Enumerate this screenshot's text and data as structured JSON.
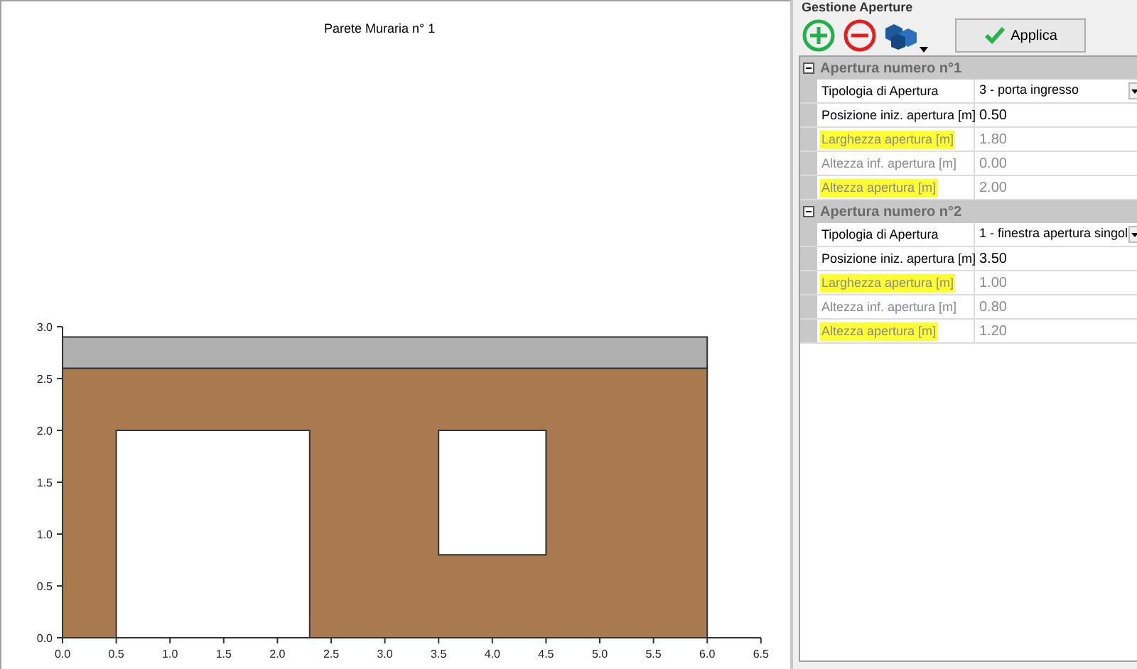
{
  "panel_title": "Gestione Aperture",
  "toolbar": {
    "apply_button": "Applica"
  },
  "sections": [
    {
      "title": "Apertura numero n°1",
      "expanded": true,
      "rows": [
        {
          "kind": "dropdown",
          "label": "Tipologia di Apertura",
          "value": "3 - porta ingresso",
          "highlighted": false,
          "disabled": false
        },
        {
          "kind": "text",
          "label": "Posizione iniz. apertura [m]",
          "value": "0.50",
          "highlighted": false,
          "disabled": false
        },
        {
          "kind": "text",
          "label": "Larghezza apertura [m]",
          "value": "1.80",
          "highlighted": true,
          "disabled": true
        },
        {
          "kind": "text",
          "label": "Altezza inf. apertura [m]",
          "value": "0.00",
          "highlighted": false,
          "disabled": true
        },
        {
          "kind": "text",
          "label": "Altezza apertura [m]",
          "value": "2.00",
          "highlighted": true,
          "disabled": true
        }
      ]
    },
    {
      "title": "Apertura numero n°2",
      "expanded": true,
      "rows": [
        {
          "kind": "dropdown",
          "label": "Tipologia di Apertura",
          "value": "1 - finestra apertura singol",
          "highlighted": false,
          "disabled": false
        },
        {
          "kind": "text",
          "label": "Posizione iniz. apertura [m]",
          "value": "3.50",
          "highlighted": false,
          "disabled": false
        },
        {
          "kind": "text",
          "label": "Larghezza apertura [m]",
          "value": "1.00",
          "highlighted": true,
          "disabled": true
        },
        {
          "kind": "text",
          "label": "Altezza inf. apertura [m]",
          "value": "0.80",
          "highlighted": false,
          "disabled": true
        },
        {
          "kind": "text",
          "label": "Altezza apertura [m]",
          "value": "1.20",
          "highlighted": true,
          "disabled": true
        }
      ]
    }
  ],
  "chart_data": {
    "type": "area",
    "title": "Parete Muraria n° 1",
    "xlim": [
      0,
      6.5
    ],
    "ylim": [
      0,
      3
    ],
    "xticks": [
      {
        "value": 0,
        "label": "0.0"
      },
      0.5,
      {
        "value": 1,
        "label": "1.0"
      },
      1.5,
      {
        "value": 2,
        "label": "2.0"
      },
      2.5,
      {
        "value": 3,
        "label": "3.0"
      },
      3.5,
      {
        "value": 4,
        "label": "4.0"
      },
      4.5,
      {
        "value": 5,
        "label": "5.0"
      },
      5.5,
      {
        "value": 6,
        "label": "6.0"
      },
      6.5
    ],
    "yticks": [
      {
        "value": 0,
        "label": "0.0"
      },
      0.5,
      {
        "value": 1,
        "label": "1.0"
      },
      1.5,
      {
        "value": 2,
        "label": "2.0"
      },
      2.5,
      {
        "value": 3,
        "label": "3.0"
      }
    ],
    "x": [
      0,
      6
    ],
    "stacked": true,
    "series": [
      {
        "color": "#a97a4f",
        "values": [
          2.6,
          2.6
        ]
      },
      {
        "color": "#b0b0b0",
        "values": [
          0.3,
          0.3
        ]
      }
    ]
  }
}
